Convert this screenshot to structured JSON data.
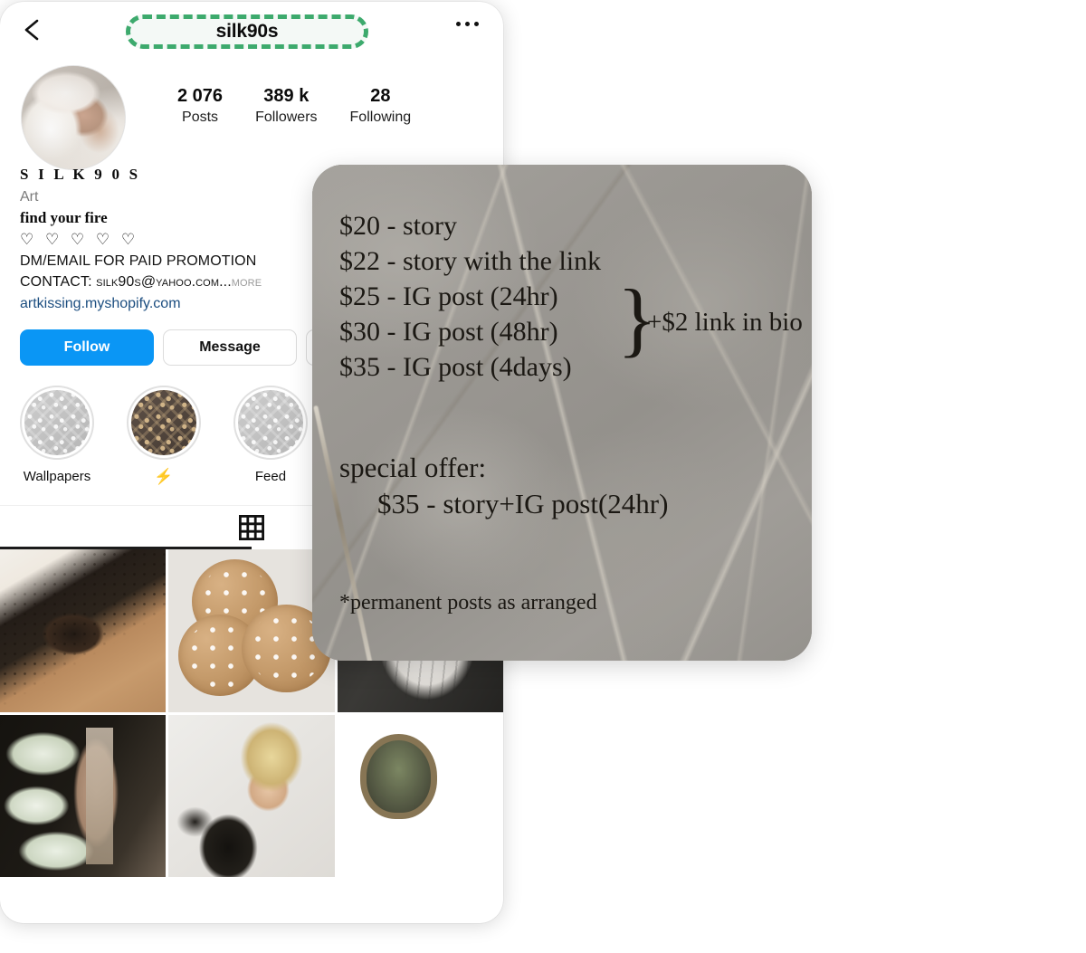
{
  "app": {
    "platform": "Instagram profile"
  },
  "header": {
    "back_icon": "chevron-left-icon",
    "username": "silk90s",
    "menu_icon": "more-options-icon",
    "highlight_color": "#3daa6d"
  },
  "profile": {
    "avatar_alt": "profile-photo",
    "stats": [
      {
        "value": "2 076",
        "label": "Posts"
      },
      {
        "value": "389 k",
        "label": "Followers"
      },
      {
        "value": "28",
        "label": "Following"
      }
    ],
    "display_name": "S I L K 9 0 S",
    "category": "Art",
    "tagline": "find your fire",
    "hearts": "♡ ♡ ♡ ♡ ♡",
    "bio_line_1": "DM/EMAIL FOR PAID PROMOTION",
    "bio_line_2": "CONTACT: silk90s@yahoo.com...",
    "more_label": "more",
    "link": "artkissing.myshopify.com",
    "link_color": "#1c4e80"
  },
  "actions": {
    "follow_label": "Follow",
    "message_label": "Message",
    "more_icon": "chevron-down-icon",
    "follow_color": "#0a96f5"
  },
  "highlights": [
    {
      "label": "Wallpapers",
      "cover": "lv-monogram-gray"
    },
    {
      "label": "⚡",
      "cover": "lv-monogram-brown"
    },
    {
      "label": "Feed",
      "cover": "lv-monogram-gray"
    }
  ],
  "tabs": [
    {
      "name": "grid",
      "icon": "grid-icon",
      "active": true
    }
  ],
  "grid_posts": [
    {
      "alt": "mesh-lingerie-photo"
    },
    {
      "alt": "lv-monogram-cookies-photo"
    },
    {
      "alt": "white-drapery-sculpture-photo"
    },
    {
      "alt": "white-tulip-buckets-photo"
    },
    {
      "alt": "blonde-woman-portrait-photo"
    },
    {
      "alt": "white-hydrangeas-mirror-photo"
    }
  ],
  "price_card": {
    "lines": [
      "$20 - story",
      "$22 - story with the link",
      "$25 - IG post (24hr)",
      "$30 - IG post (48hr)",
      "$35 - IG post (4days)"
    ],
    "brace": "}",
    "brace_note": "+$2 link in bio",
    "special_title": "special offer:",
    "special_body": "$35 - story+IG post(24hr)",
    "footnote": "*permanent posts as arranged",
    "background": "gray-marble-texture"
  }
}
